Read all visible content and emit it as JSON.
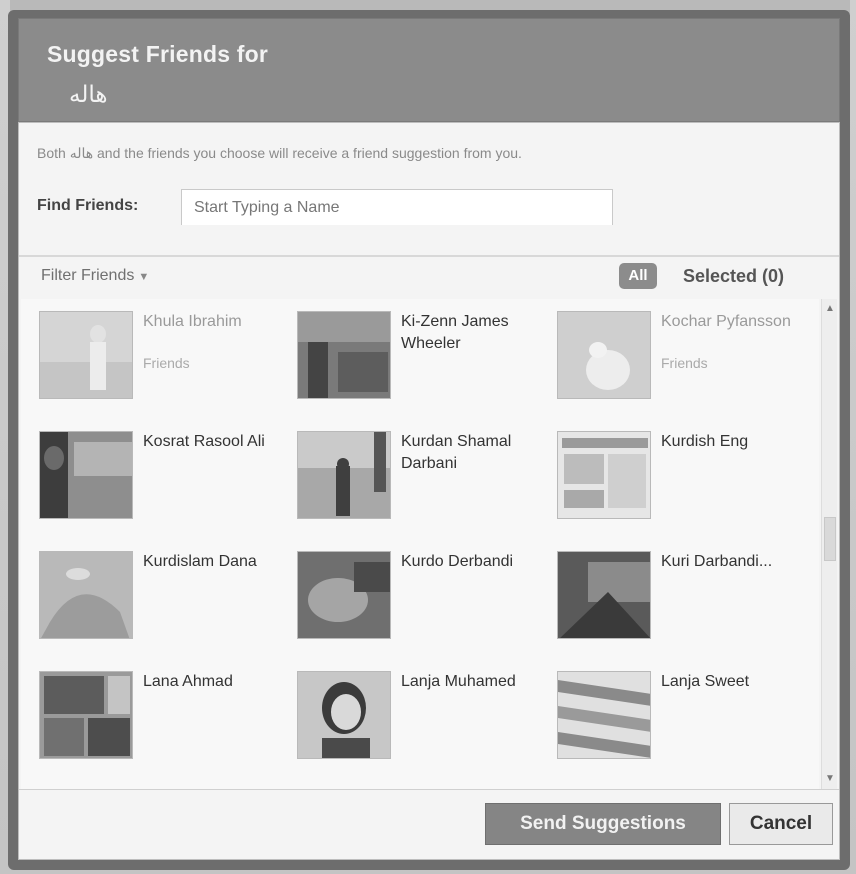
{
  "dialog": {
    "title": "Suggest Friends for",
    "subtitle": "هاله",
    "info": "Both هاله and the friends you choose will receive a friend suggestion from you.",
    "find_label": "Find Friends:",
    "find_placeholder": "Start Typing a Name",
    "filter_label": "Filter Friends",
    "all_label": "All",
    "selected_label": "Selected (0)",
    "send_label": "Send Suggestions",
    "cancel_label": "Cancel"
  },
  "friends": [
    {
      "name": "Khula Ibrahim",
      "sub": "Friends",
      "dim": true
    },
    {
      "name": "Ki-Zenn James Wheeler",
      "sub": "",
      "dim": false
    },
    {
      "name": "Kochar Pyfansson",
      "sub": "Friends",
      "dim": true
    },
    {
      "name": "Kosrat Rasool Ali",
      "sub": "",
      "dim": false
    },
    {
      "name": "Kurdan Shamal Darbani",
      "sub": "",
      "dim": false
    },
    {
      "name": "Kurdish Eng",
      "sub": "",
      "dim": false
    },
    {
      "name": "Kurdislam Dana",
      "sub": "",
      "dim": false
    },
    {
      "name": "Kurdo Derbandi",
      "sub": "",
      "dim": false
    },
    {
      "name": "Kuri Darbandi...",
      "sub": "",
      "dim": false
    },
    {
      "name": "Lana Ahmad",
      "sub": "",
      "dim": false
    },
    {
      "name": "Lanja Muhamed",
      "sub": "",
      "dim": false
    },
    {
      "name": "Lanja Sweet",
      "sub": "",
      "dim": false
    }
  ],
  "colors": {
    "title_bg": "#8b8b8b",
    "dialog_frame": "#6d6d6d",
    "primary_button": "#858585"
  }
}
